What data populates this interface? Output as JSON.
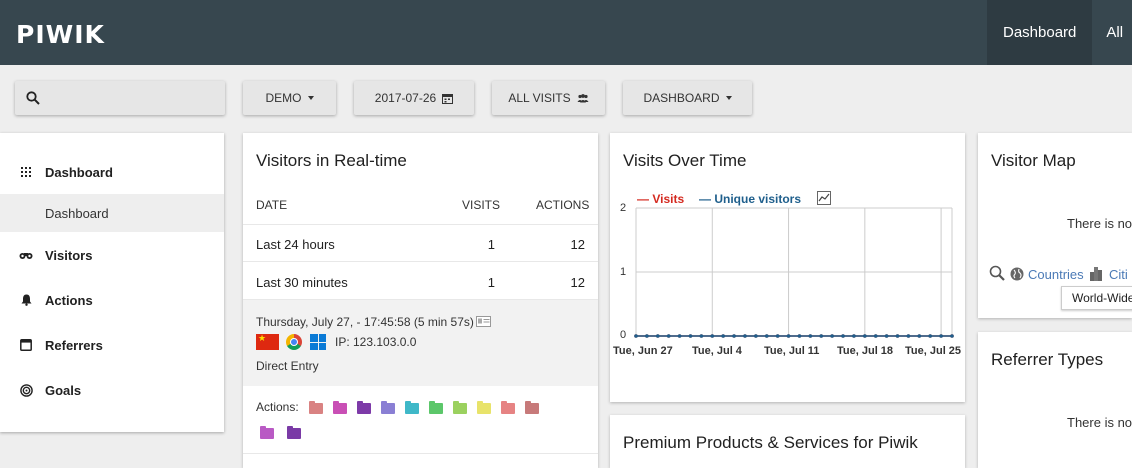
{
  "app": {
    "logo": "PIWIK"
  },
  "topnav": {
    "items": [
      "Dashboard",
      "All"
    ]
  },
  "toolbar": {
    "search_placeholder": "",
    "site_label": "DEMO",
    "date_label": "2017-07-26",
    "segment_label": "ALL VISITS",
    "dashboard_label": "DASHBOARD"
  },
  "sidebar": {
    "items": [
      {
        "label": "Dashboard",
        "icon": "grid-icon"
      },
      {
        "label": "Visitors",
        "icon": "binoculars-icon"
      },
      {
        "label": "Actions",
        "icon": "bell-icon"
      },
      {
        "label": "Referrers",
        "icon": "window-icon"
      },
      {
        "label": "Goals",
        "icon": "target-icon"
      }
    ],
    "sub_item": "Dashboard"
  },
  "realtime": {
    "title": "Visitors in Real-time",
    "columns": [
      "DATE",
      "VISITS",
      "ACTIONS"
    ],
    "rows": [
      {
        "date": "Last 24 hours",
        "visits": "1",
        "actions": "12"
      },
      {
        "date": "Last 30 minutes",
        "visits": "1",
        "actions": "12"
      }
    ],
    "visit": {
      "datetime": "Thursday, July 27, - 17:45:58 (5 min 57s)",
      "ip": "IP: 123.103.0.0",
      "referrer": "Direct Entry",
      "actions_label": "Actions:",
      "action_colors": [
        "#d98282",
        "#c94fb5",
        "#7d3aa8",
        "#8a7fd4",
        "#3fb8c8",
        "#5cc76a",
        "#9bd15f",
        "#e8e36a",
        "#e68383",
        "#c77a7a",
        "#b95ac4",
        "#7a3aa6"
      ]
    }
  },
  "visits_chart": {
    "title": "Visits Over Time",
    "legend": [
      {
        "name": "Visits",
        "color": "#d4291f"
      },
      {
        "name": "Unique visitors",
        "color": "#1f5f8c"
      }
    ]
  },
  "chart_data": {
    "type": "line",
    "title": "Visits Over Time",
    "xlabel": "",
    "ylabel": "",
    "ylim": [
      0,
      2
    ],
    "yticks": [
      "0",
      "1",
      "2"
    ],
    "xticks": [
      "Tue, Jun 27",
      "Tue, Jul 4",
      "Tue, Jul 11",
      "Tue, Jul 18",
      "Tue, Jul 25"
    ],
    "grid": true,
    "legend_position": "top-left",
    "series": [
      {
        "name": "Visits",
        "color": "#d4291f",
        "values": [
          0,
          0,
          0,
          0,
          0,
          0,
          0,
          0,
          0,
          0,
          0,
          0,
          0,
          0,
          0,
          0,
          0,
          0,
          0,
          0,
          0,
          0,
          0,
          0,
          0,
          0,
          0,
          0,
          0,
          0
        ]
      },
      {
        "name": "Unique visitors",
        "color": "#1f5f8c",
        "values": [
          0,
          0,
          0,
          0,
          0,
          0,
          0,
          0,
          0,
          0,
          0,
          0,
          0,
          0,
          0,
          0,
          0,
          0,
          0,
          0,
          0,
          0,
          0,
          0,
          0,
          0,
          0,
          0,
          0,
          0
        ]
      }
    ]
  },
  "visitor_map": {
    "title": "Visitor Map",
    "message": "There is no",
    "countries_label": "Countries",
    "cities_label": "Citi",
    "tooltip": "World-Wide"
  },
  "premium": {
    "title": "Premium Products & Services for Piwik"
  },
  "referrer_types": {
    "title": "Referrer Types",
    "message": "There is no"
  }
}
